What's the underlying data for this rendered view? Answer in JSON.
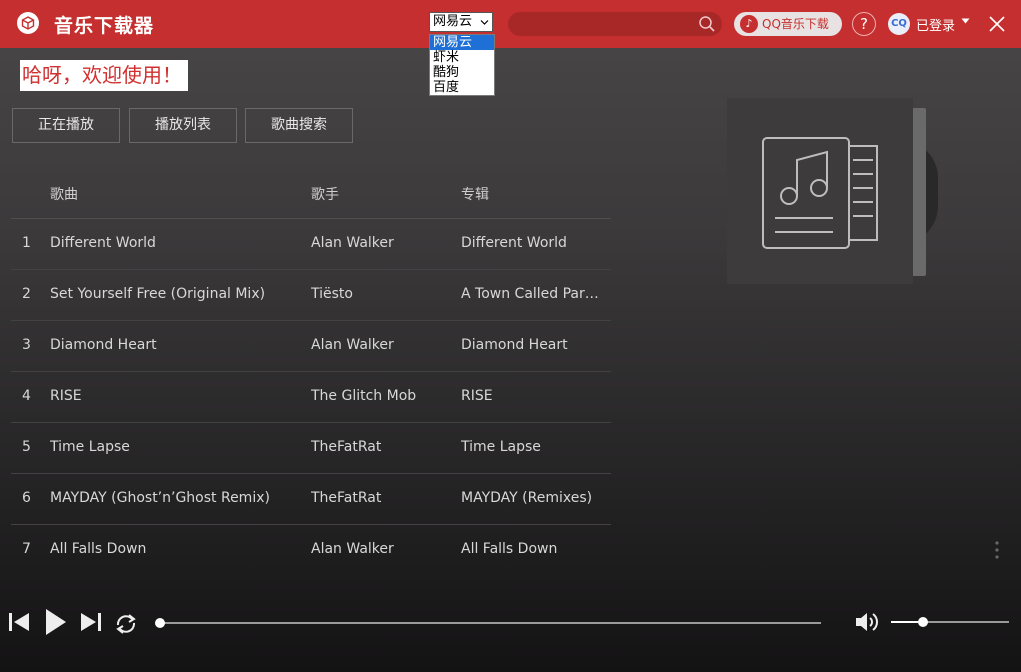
{
  "app": {
    "title": "音乐下载器",
    "icon": "logo-icon"
  },
  "header": {
    "source_select": {
      "value": "网易云",
      "options": [
        "网易云",
        "虾米",
        "酷狗",
        "百度"
      ],
      "selected_index": 0
    },
    "search": {
      "value": "",
      "placeholder": ""
    },
    "qq_download_label": "QQ音乐下载",
    "help_label": "?",
    "avatar_text": "CQ",
    "login_status": "已登录",
    "accent_color": "#c62f2f"
  },
  "welcome": "哈呀，欢迎使用！",
  "tabs": [
    {
      "label": "正在播放"
    },
    {
      "label": "播放列表"
    },
    {
      "label": "歌曲搜索"
    }
  ],
  "table": {
    "columns": {
      "song": "歌曲",
      "artist": "歌手",
      "album": "专辑"
    },
    "rows": [
      {
        "idx": "1",
        "song": "Different World",
        "artist": "Alan Walker",
        "album": "Different World"
      },
      {
        "idx": "2",
        "song": "Set Yourself Free (Original Mix)",
        "artist": "Tiësto",
        "album": "A Town Called Para…"
      },
      {
        "idx": "3",
        "song": "Diamond Heart",
        "artist": "Alan Walker",
        "album": "Diamond Heart"
      },
      {
        "idx": "4",
        "song": "RISE",
        "artist": "The Glitch Mob",
        "album": "RISE"
      },
      {
        "idx": "5",
        "song": "Time Lapse",
        "artist": "TheFatRat",
        "album": "Time Lapse"
      },
      {
        "idx": "6",
        "song": "MAYDAY (Ghost’n’Ghost Remix)",
        "artist": "TheFatRat",
        "album": "MAYDAY (Remixes)"
      },
      {
        "idx": "7",
        "song": "All Falls Down",
        "artist": "Alan Walker",
        "album": "All Falls Down"
      }
    ]
  },
  "player": {
    "progress": 0,
    "volume": 0.27,
    "icons": [
      "previous-icon",
      "play-icon",
      "next-icon",
      "repeat-icon",
      "volume-icon"
    ]
  }
}
